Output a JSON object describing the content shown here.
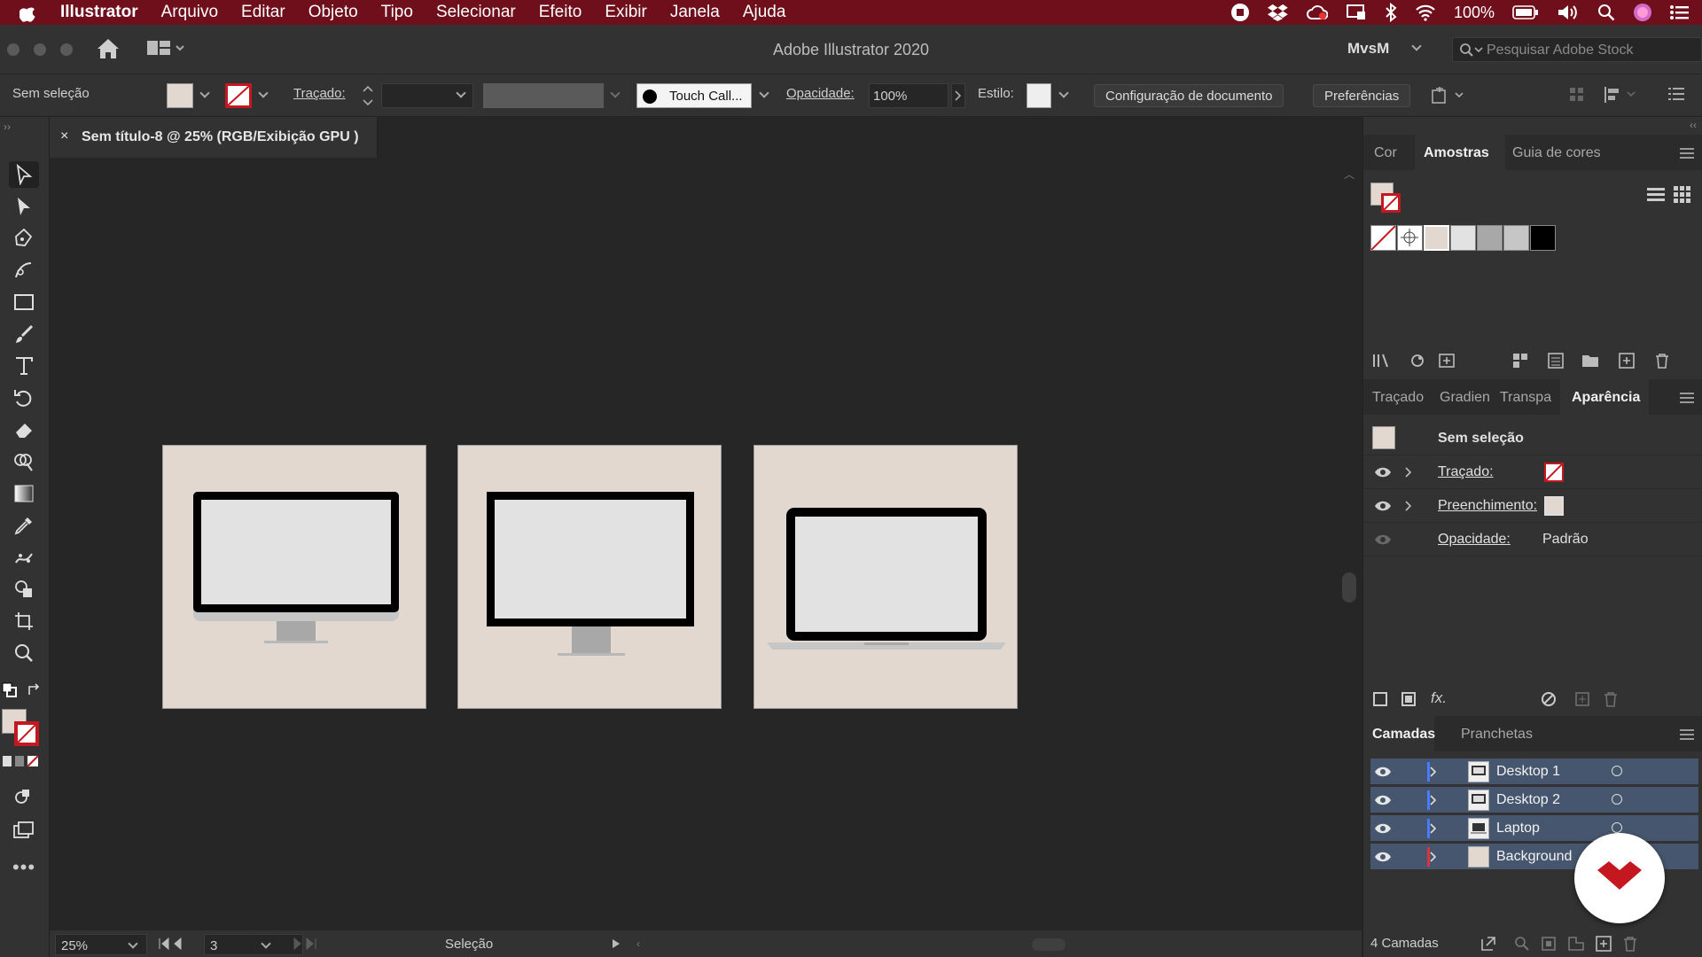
{
  "menubar": {
    "app": "Illustrator",
    "items": [
      "Arquivo",
      "Editar",
      "Objeto",
      "Tipo",
      "Selecionar",
      "Efeito",
      "Exibir",
      "Janela",
      "Ajuda"
    ],
    "battery": "100%"
  },
  "window": {
    "title": "Adobe Illustrator 2020",
    "workspace": "MvsM",
    "stock_placeholder": "Pesquisar Adobe Stock"
  },
  "control": {
    "selection": "Sem seleção",
    "stroke_label": "Traçado:",
    "brush": "Touch Call...",
    "opacity_label": "Opacidade:",
    "opacity_value": "100%",
    "style_label": "Estilo:",
    "doc_setup": "Configuração de documento",
    "preferences": "Preferências"
  },
  "document": {
    "tab_title": "Sem título-8 @ 25% (RGB/Exibição GPU )",
    "close": "×"
  },
  "status": {
    "zoom": "25%",
    "artboard": "3",
    "tool": "Seleção"
  },
  "swatches_panel": {
    "tabs": [
      "Cor",
      "Amostras",
      "Guia de cores"
    ],
    "active": "Amostras"
  },
  "appearance_panel": {
    "tabs": [
      "Traçado",
      "Gradien",
      "Transpa",
      "Aparência"
    ],
    "active": "Aparência",
    "header": "Sem seleção",
    "rows": [
      {
        "label": "Traçado:"
      },
      {
        "label": "Preenchimento:"
      },
      {
        "label": "Opacidade:",
        "value": "Padrão"
      }
    ],
    "fx": "fx."
  },
  "layers_panel": {
    "tabs": [
      "Camadas",
      "Pranchetas"
    ],
    "active": "Camadas",
    "layers": [
      {
        "name": "Desktop 1",
        "color": "#4a7bff"
      },
      {
        "name": "Desktop 2",
        "color": "#4a7bff"
      },
      {
        "name": "Laptop",
        "color": "#4a7bff"
      },
      {
        "name": "Background",
        "color": "#e0323c"
      }
    ],
    "count": "4 Camadas"
  },
  "colors": {
    "menubar": "#6e0f1b",
    "artboard": "#e3d8cf",
    "screen": "#e2e2e2",
    "stand": "#c4c4c4",
    "layer_highlight": "#46566e",
    "logo": "#c41720"
  }
}
